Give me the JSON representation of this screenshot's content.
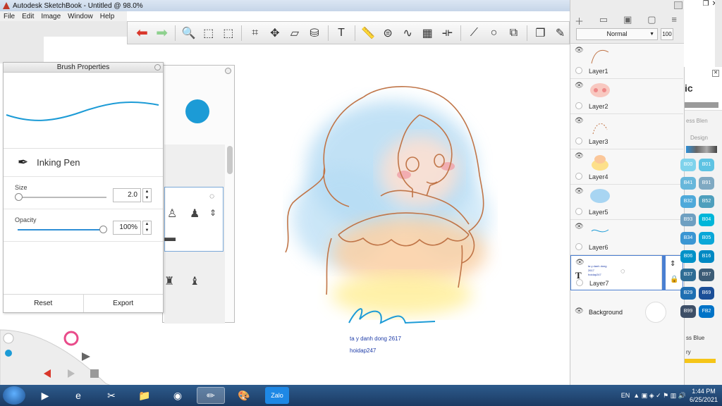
{
  "window": {
    "title": "Autodesk SketchBook - Untitled @ 98.0%"
  },
  "menu": [
    "File",
    "Edit",
    "Image",
    "Window",
    "Help"
  ],
  "toolbar": {
    "items": [
      {
        "name": "undo-icon",
        "glyph": "⬅"
      },
      {
        "name": "redo-icon",
        "glyph": "➡"
      },
      {
        "name": "zoom-icon",
        "glyph": "🔍"
      },
      {
        "name": "rect-select-icon",
        "glyph": "⬚"
      },
      {
        "name": "lasso-select-icon",
        "glyph": "⬚"
      },
      {
        "name": "crop-icon",
        "glyph": "⌗"
      },
      {
        "name": "move-icon",
        "glyph": "✥"
      },
      {
        "name": "distort-icon",
        "glyph": "▱"
      },
      {
        "name": "fill-icon",
        "glyph": "⛁"
      },
      {
        "name": "text-icon",
        "glyph": "T"
      },
      {
        "name": "ruler-icon",
        "glyph": "📏"
      },
      {
        "name": "ellipse-guide-icon",
        "glyph": "⊜"
      },
      {
        "name": "french-curve-icon",
        "glyph": "∿"
      },
      {
        "name": "perspective-icon",
        "glyph": "▦"
      },
      {
        "name": "symmetry-icon",
        "glyph": "⟛"
      },
      {
        "name": "line-icon",
        "glyph": "⟋"
      },
      {
        "name": "circle-icon",
        "glyph": "○"
      },
      {
        "name": "shapes-icon",
        "glyph": "⧉"
      },
      {
        "name": "layers-toggle-icon",
        "glyph": "❐"
      },
      {
        "name": "brushes-toggle-icon",
        "glyph": "✎"
      }
    ]
  },
  "brush_properties": {
    "title": "Brush Properties",
    "brush_name": "Inking Pen",
    "size_label": "Size",
    "size_value": "2.0",
    "opacity_label": "Opacity",
    "opacity_value": "100%",
    "reset_label": "Reset",
    "export_label": "Export",
    "stroke_color": "#1c9bd6"
  },
  "colors": {
    "current": "#1c9bd6",
    "caption": "#1e3ca8",
    "active_border": "#4a7fd1"
  },
  "canvas": {
    "caption_line1": "ta y danh dong 2617",
    "caption_line2": "hoidap247"
  },
  "layers": {
    "blend_mode": "Normal",
    "opacity": "100",
    "items": [
      {
        "name": "Layer1"
      },
      {
        "name": "Layer2"
      },
      {
        "name": "Layer3"
      },
      {
        "name": "Layer4"
      },
      {
        "name": "Layer5"
      },
      {
        "name": "Layer6"
      },
      {
        "name": "Layer7",
        "active": true,
        "text_preview_1": "ta y danh dong 2617",
        "text_preview_2": "hoidap247"
      }
    ],
    "background_label": "Background"
  },
  "copic": {
    "partial_logo": "ic",
    "label_blend": "ess Blen",
    "label_design": "Design",
    "swatches": [
      {
        "left": "B00",
        "right": "B01",
        "lc": "#7fd3ec",
        "rc": "#5ec3e3"
      },
      {
        "left": "B41",
        "right": "B91",
        "lc": "#67b7db",
        "rc": "#7fa9c2"
      },
      {
        "left": "B32",
        "right": "B52",
        "lc": "#4ea9da",
        "rc": "#4e9fbd"
      },
      {
        "left": "B93",
        "right": "B04",
        "lc": "#6e9fc1",
        "rc": "#00b6d9"
      },
      {
        "left": "B34",
        "right": "B05",
        "lc": "#3b96d3",
        "rc": "#0aa7d8"
      },
      {
        "left": "B06",
        "right": "B16",
        "lc": "#0092c8",
        "rc": "#0089c3"
      },
      {
        "left": "B37",
        "right": "B97",
        "lc": "#2f6d95",
        "rc": "#3c5c76"
      },
      {
        "left": "B29",
        "right": "B69",
        "lc": "#1f6fb2",
        "rc": "#1c4f98"
      },
      {
        "left": "B99",
        "right": "FB2",
        "lc": "#3e4f67",
        "rc": "#0073c7"
      }
    ],
    "footer_1": "ss Blue",
    "footer_2": "ry"
  },
  "taskbar": {
    "time": "1:44 PM",
    "date": "6/25/2021",
    "lang": "EN",
    "apps": [
      {
        "name": "media-player-icon",
        "glyph": "▶"
      },
      {
        "name": "internet-explorer-icon",
        "glyph": "e"
      },
      {
        "name": "snipping-tool-icon",
        "glyph": "✂"
      },
      {
        "name": "file-explorer-icon",
        "glyph": "📁"
      },
      {
        "name": "chrome-icon",
        "glyph": "◉"
      },
      {
        "name": "sketchbook-icon",
        "glyph": "✏"
      },
      {
        "name": "paint-icon",
        "glyph": "🎨"
      },
      {
        "name": "zalo-icon",
        "glyph": "Zalo"
      }
    ]
  }
}
